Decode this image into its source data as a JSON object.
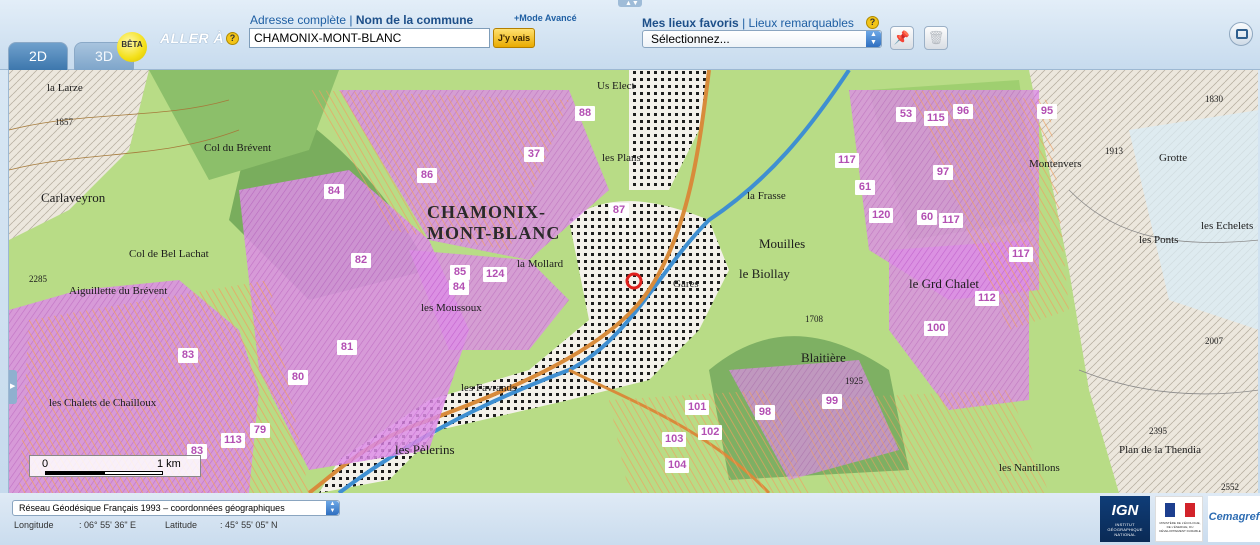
{
  "tabs": {
    "tab_2d": "2D",
    "tab_3d": "3D",
    "beta_badge": "BÊTA"
  },
  "goto": {
    "label": "ALLER À",
    "link_full_address": "Adresse complète",
    "separator": "|",
    "link_commune": "Nom de la commune",
    "advanced_mode": "+Mode Avancé",
    "search_value": "CHAMONIX-MONT-BLANC",
    "go_button": "J'y vais",
    "help": "?"
  },
  "favorites": {
    "link_favorites": "Mes lieux favoris",
    "separator": "|",
    "link_remarkable": "Lieux remarquables",
    "select_value": "Sélectionnez...",
    "help": "?"
  },
  "map": {
    "places": [
      "la Larze",
      "Col du Brévent",
      "Carlaveyron",
      "Col de Bel Lachat",
      "Aiguillette du Brévent",
      "les Chalets de Chailloux",
      "Us Elect",
      "les Plans",
      "CHAMONIX-MONT-BLANC",
      "la Mollard",
      "les Moussoux",
      "Gares",
      "les Favrands",
      "les Pèlerins",
      "le Biollay",
      "Mouilles",
      "la Frasse",
      "Blaitière",
      "le Grd Chalet",
      "Grotte",
      "les Ponts",
      "les Echelets",
      "Montenvers",
      "les Nantillons",
      "Plan de la Thendia"
    ],
    "elevations": [
      "1857",
      "2285",
      "1830",
      "1913",
      "2007",
      "1708",
      "1925",
      "2395",
      "2552"
    ],
    "zones": [
      "88",
      "37",
      "86",
      "84",
      "87",
      "82",
      "85",
      "84",
      "124",
      "81",
      "83",
      "80",
      "79",
      "113",
      "83",
      "101",
      "102",
      "103",
      "104",
      "98",
      "99",
      "53",
      "115",
      "96",
      "95",
      "117",
      "61",
      "97",
      "120",
      "60",
      "117",
      "117",
      "112",
      "100"
    ],
    "scale": {
      "start": "0",
      "end": "1 km"
    }
  },
  "bottom": {
    "coord_system": "Réseau Géodésique Français 1993 – coordonnées géographiques",
    "longitude_label": "Longitude",
    "longitude_value": ": 06° 55' 36\" E",
    "latitude_label": "Latitude",
    "latitude_value": ": 45° 55' 05\" N",
    "logos": {
      "ign": "IGN",
      "ign_sub": "INSTITUT GÉOGRAPHIQUE NATIONAL",
      "rf": "MINISTÈRE DE L'ÉCOLOGIE, DE L'ÉNERGIE, DU DÉVELOPPEMENT DURABLE",
      "cemagref": "Cemagref"
    }
  },
  "colors": {
    "accent": "#1f5fa3",
    "zone_pink": "#d98ce0",
    "zone_orange": "#f0a46a",
    "forest": "#7fb06a",
    "meadow": "#b9de82"
  }
}
